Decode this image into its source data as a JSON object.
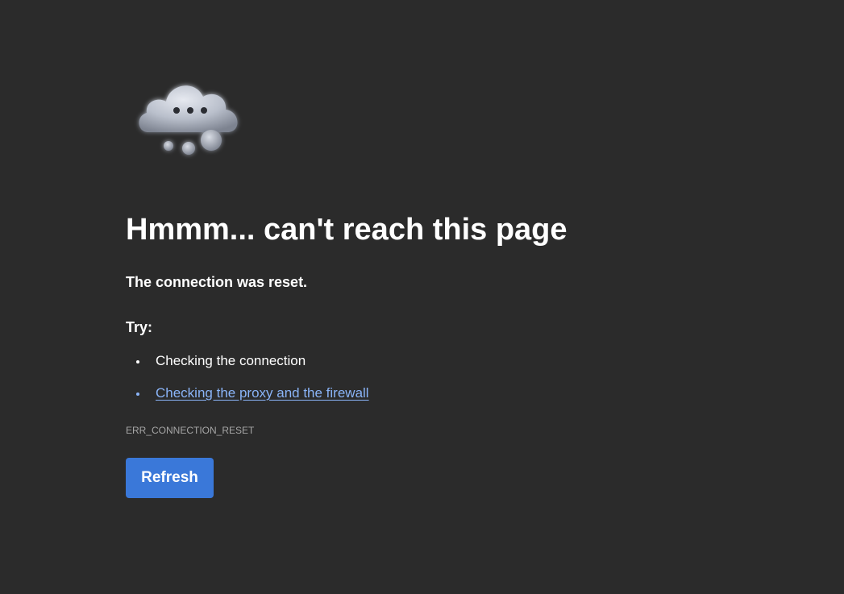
{
  "illustration": {
    "icon": "thinking-cloud-icon"
  },
  "error": {
    "title": "Hmmm... can't reach this page",
    "message": "The connection was reset.",
    "try_heading": "Try:",
    "suggestions": [
      {
        "label": "Checking the connection",
        "is_link": false
      },
      {
        "label": "Checking the proxy and the firewall",
        "is_link": true
      }
    ],
    "code": "ERR_CONNECTION_RESET"
  },
  "actions": {
    "refresh_label": "Refresh"
  },
  "colors": {
    "background": "#2b2b2b",
    "text": "#ffffff",
    "link": "#8ab4f8",
    "button": "#3a78d9",
    "muted": "#a6a6a6"
  }
}
